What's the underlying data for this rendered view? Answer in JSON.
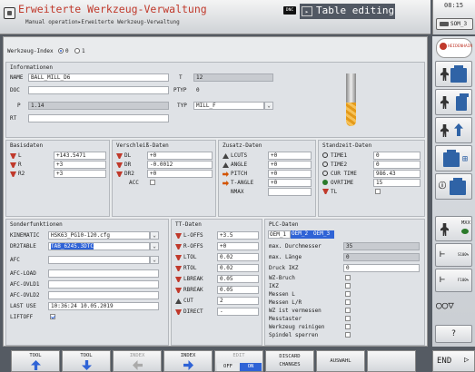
{
  "header": {
    "title": "Erweiterte Werkzeug-Verwaltung",
    "breadcrumb": "Manual operation▸Erweiterte Werkzeug-Verwaltung",
    "dnc_badge": "DNC",
    "editing_label": "Table editing",
    "clock": "08:15",
    "som_label": "SOM_3"
  },
  "werkzeug_index": {
    "label": "Werkzeug-Index",
    "opt0": "0",
    "opt1": "1"
  },
  "info": {
    "title": "Informationen",
    "name_label": "NAME",
    "name_value": "BALL_MILL_D6",
    "doc_label": "DOC",
    "doc_value": "",
    "p_label": "P",
    "p_value": "1.14",
    "rt_label": "RT",
    "rt_value": "",
    "t_label": "T",
    "t_value": "12",
    "ptyp_label": "PTYP",
    "ptyp_value": "0",
    "typ_label": "TYP",
    "typ_value": "MILL_F"
  },
  "basis": {
    "title": "Basisdaten",
    "rows": [
      {
        "label": "L",
        "value": "+143.5471"
      },
      {
        "label": "R",
        "value": "+3"
      },
      {
        "label": "R2",
        "value": "+3"
      }
    ]
  },
  "verschleiss": {
    "title": "Verschleiß-Daten",
    "rows": [
      {
        "label": "DL",
        "value": "+0"
      },
      {
        "label": "DR",
        "value": "-0.0012"
      },
      {
        "label": "DR2",
        "value": "+0"
      },
      {
        "label": "ACC",
        "value": ""
      }
    ]
  },
  "zusatz": {
    "title": "Zusatz-Daten",
    "rows": [
      {
        "label": "LCUTS",
        "value": "+0"
      },
      {
        "label": "ANGLE",
        "value": "+0"
      },
      {
        "label": "PITCH",
        "value": "+0"
      },
      {
        "label": "T-ANGLE",
        "value": "+0"
      },
      {
        "label": "NMAX",
        "value": ""
      }
    ]
  },
  "standzeit": {
    "title": "Standzeit-Daten",
    "rows": [
      {
        "label": "TIME1",
        "value": "0"
      },
      {
        "label": "TIME2",
        "value": "0"
      },
      {
        "label": "CUR TIME",
        "value": "986.43"
      },
      {
        "label": "OVRTIME",
        "value": "15"
      },
      {
        "label": "TL",
        "value": ""
      }
    ]
  },
  "sonder": {
    "title": "Sonderfunktionen",
    "rows": [
      {
        "label": "KINEMATIC",
        "value": "HSK63_PG10-120.cfg"
      },
      {
        "label": "DR2TABLE",
        "value": "TAB_6245.3DTC"
      },
      {
        "label": "AFC",
        "value": ""
      },
      {
        "label": "AFC-LOAD",
        "value": ""
      },
      {
        "label": "AFC-OVLD1",
        "value": ""
      },
      {
        "label": "AFC-OVLD2",
        "value": ""
      },
      {
        "label": "LAST USE",
        "value": "10:36:24 10.05.2019"
      },
      {
        "label": "LIFTOFF",
        "value": ""
      }
    ]
  },
  "tt": {
    "title": "TT-Daten",
    "rows": [
      {
        "label": "L-OFFS",
        "value": "+3.5"
      },
      {
        "label": "R-OFFS",
        "value": "+0"
      },
      {
        "label": "LTOL",
        "value": "0.02"
      },
      {
        "label": "RTOL",
        "value": "0.02"
      },
      {
        "label": "LBREAK",
        "value": "0.05"
      },
      {
        "label": "RBREAK",
        "value": "0.05"
      },
      {
        "label": "CUT",
        "value": "2"
      },
      {
        "label": "DIRECT",
        "value": "-"
      }
    ]
  },
  "plc": {
    "title": "PLC-Daten",
    "tabs": [
      "OEM_1",
      "OEM_2",
      "OEM_3"
    ],
    "rows": [
      {
        "label": "max. Durchmesser",
        "value": "35"
      },
      {
        "label": "max. Länge",
        "value": "0"
      },
      {
        "label": "Druck IKZ",
        "value": "0"
      },
      {
        "label": "WZ-Bruch",
        "value": ""
      },
      {
        "label": "IKZ",
        "value": ""
      },
      {
        "label": "Messen L",
        "value": ""
      },
      {
        "label": "Messen L/R",
        "value": ""
      },
      {
        "label": "WZ ist vermessen",
        "value": ""
      },
      {
        "label": "Messtaster",
        "value": ""
      },
      {
        "label": "Werkzeug reinigen",
        "value": ""
      },
      {
        "label": "Spindel sperren",
        "value": ""
      }
    ]
  },
  "sidebar": {
    "heidenhain": "HEIDENHAIN",
    "s100a": "S100%",
    "s100b": "F100%",
    "mxx": "MXX",
    "question": "?"
  },
  "softkeys": {
    "k1": "TOOL",
    "k2": "TOOL",
    "k3": "INDEX",
    "k4": "INDEX",
    "k5": "EDIT",
    "k5_off": "OFF",
    "k5_on": "ON",
    "k6a": "DISCARD",
    "k6b": "CHANGES",
    "k7": "AUSWAHL",
    "end": "END"
  }
}
